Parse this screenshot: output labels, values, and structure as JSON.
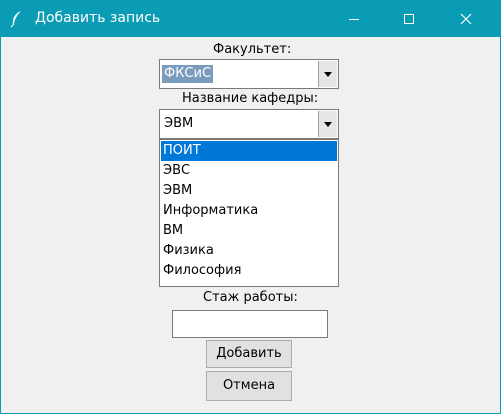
{
  "window": {
    "title": "Добавить запись",
    "icon": "feather-icon",
    "controls": [
      "minimize-icon",
      "maximize-icon",
      "close-icon"
    ],
    "title_bar_color": "#0a9bb5"
  },
  "form": {
    "faculty_label": "Факультет:",
    "faculty_value": "ФКСиС",
    "department_label": "Название кафедры:",
    "department_value": "ЭВМ",
    "department_options": [
      "ПОИТ",
      "ЭВС",
      "ЭВМ",
      "Информатика",
      "ВМ",
      "Физика",
      "Философия"
    ],
    "highlighted_option": "ПОИТ",
    "experience_label": "Стаж работы:",
    "experience_value": "",
    "add_label": "Добавить",
    "cancel_label": "Отмена"
  },
  "colors": {
    "selection": "#0078d7",
    "text_selection": "#7b9dbd",
    "background": "#f0f0f0"
  }
}
